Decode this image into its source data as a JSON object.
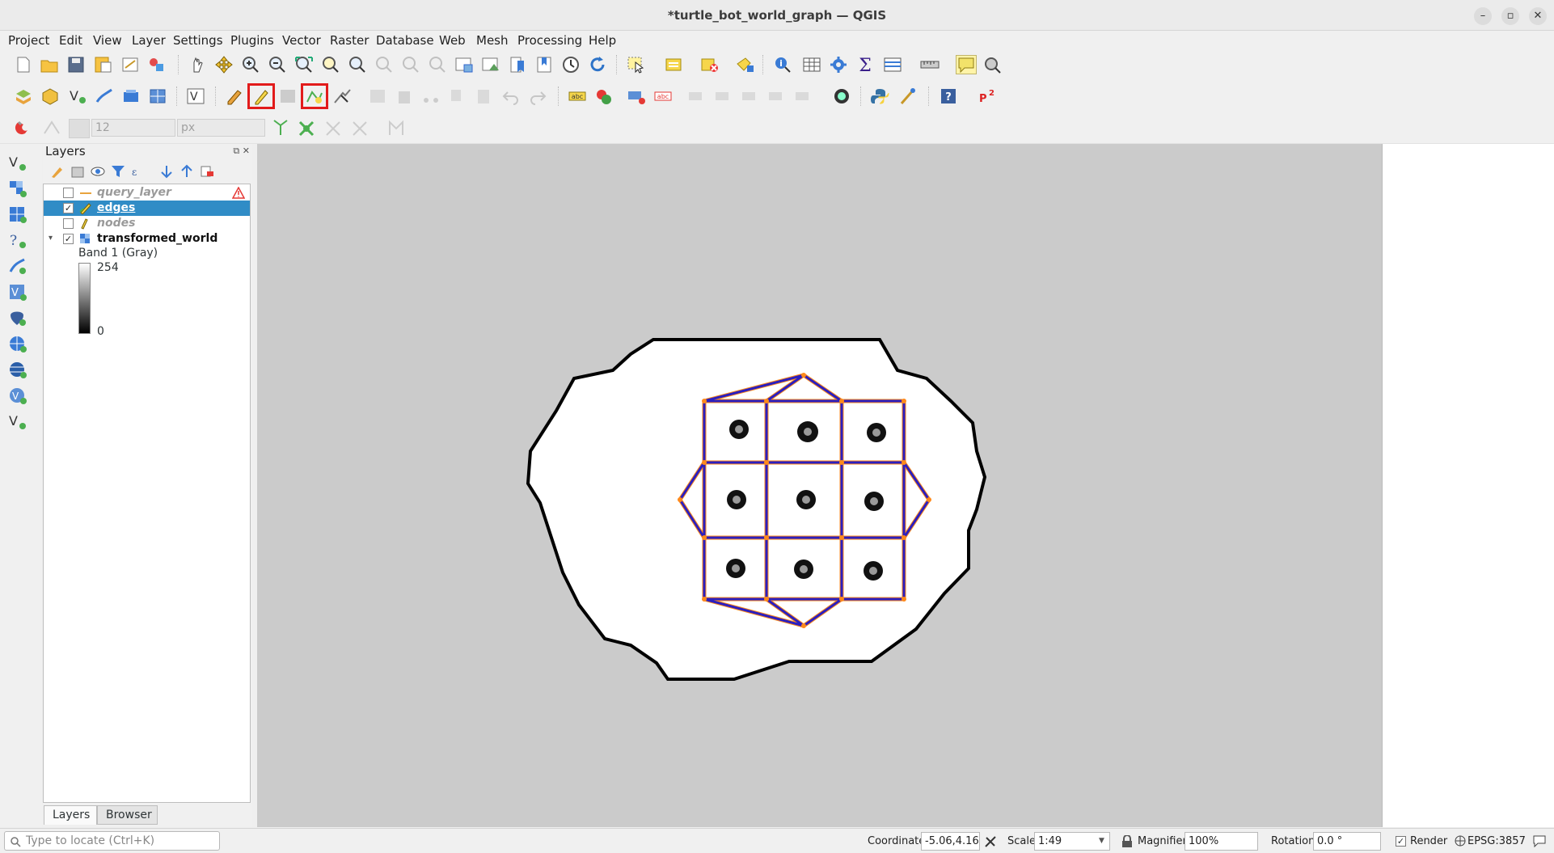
{
  "window": {
    "title": "*turtle_bot_world_graph — QGIS"
  },
  "menu": [
    "Project",
    "Edit",
    "View",
    "Layer",
    "Settings",
    "Plugins",
    "Vector",
    "Raster",
    "Database",
    "Web",
    "Mesh",
    "Processing",
    "Help"
  ],
  "snapping": {
    "tolerance": "12",
    "unit": "px"
  },
  "layers_panel": {
    "title": "Layers",
    "layers": [
      {
        "name": "query_layer",
        "checked": false,
        "state": "warning"
      },
      {
        "name": "edges",
        "checked": true,
        "state": "selected"
      },
      {
        "name": "nodes",
        "checked": false,
        "state": "normal"
      },
      {
        "name": "transformed_world",
        "checked": true,
        "state": "raster"
      }
    ],
    "band": {
      "label": "Band 1 (Gray)",
      "max": "254",
      "min": "0"
    },
    "tabs": [
      "Layers",
      "Browser"
    ]
  },
  "statusbar": {
    "locate_placeholder": "Type to locate (Ctrl+K)",
    "coordinate_label": "Coordinate",
    "coordinate": "-5.06,4.16",
    "scale_label": "Scale",
    "scale": "1:49",
    "magnifier_label": "Magnifier",
    "magnifier": "100%",
    "rotation_label": "Rotation",
    "rotation": "0.0 °",
    "render_label": "Render",
    "crs": "EPSG:3857"
  },
  "colors": {
    "accent": "#308cc6",
    "highlight": "#e21b1b",
    "edge": "#2b1fbf",
    "node": "#ff8a1c"
  }
}
